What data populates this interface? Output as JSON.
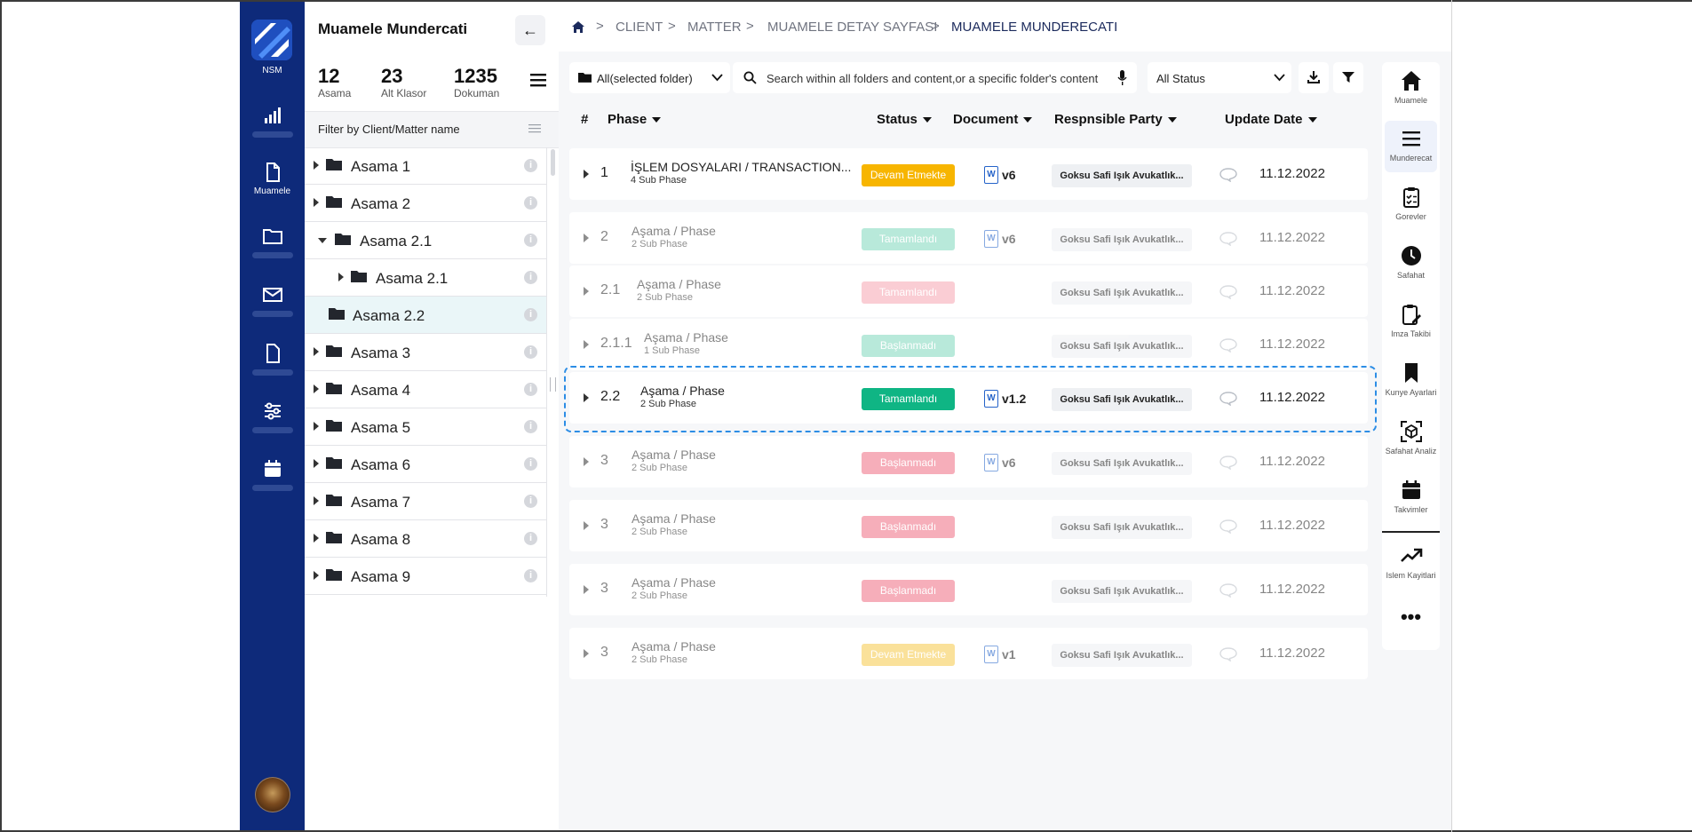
{
  "rail": {
    "logo_text": "NSM",
    "items": [
      {
        "icon": "chart-bars-icon",
        "label": ""
      },
      {
        "icon": "document-icon",
        "label": "Muamele"
      },
      {
        "icon": "folder-icon",
        "label": ""
      },
      {
        "icon": "mail-icon",
        "label": ""
      },
      {
        "icon": "file-icon",
        "label": ""
      },
      {
        "icon": "sliders-icon",
        "label": ""
      },
      {
        "icon": "calendar-icon",
        "label": ""
      }
    ]
  },
  "panel": {
    "title": "Muamele Mundercati",
    "stats": [
      {
        "value": "12",
        "label": "Asama"
      },
      {
        "value": "23",
        "label": "Alt Klasor"
      },
      {
        "value": "1235",
        "label": "Dokuman"
      }
    ],
    "filter_placeholder": "Filter by Client/Matter name",
    "tree": [
      {
        "label": "Asama 1"
      },
      {
        "label": "Asama 2"
      },
      {
        "label": "Asama 2.1"
      },
      {
        "label": "Asama 2.1"
      },
      {
        "label": "Asama 2.2"
      },
      {
        "label": "Asama 3"
      },
      {
        "label": "Asama 4"
      },
      {
        "label": "Asama 5"
      },
      {
        "label": "Asama 6"
      },
      {
        "label": "Asama 7"
      },
      {
        "label": "Asama 8"
      },
      {
        "label": "Asama 9"
      }
    ]
  },
  "breadcrumb": [
    "CLIENT",
    "MATTER",
    "MUAMELE DETAY SAYFASI",
    "MUAMELE MUNDERECATI"
  ],
  "toolbar": {
    "folder_select": "All(selected folder)",
    "search_placeholder": "Search within all folders and content,or a specific folder's content",
    "status_select": "All Status"
  },
  "grid": {
    "columns": {
      "hash": "#",
      "phase": "Phase",
      "status": "Status",
      "document": "Document",
      "party": "Respnsible Party",
      "date": "Update Date"
    },
    "rows": [
      {
        "num": "1",
        "title": "İŞLEM DOSYALARI / TRANSACTION...",
        "sub": "4 Sub Phase",
        "status": "Devam Etmekte",
        "status_color": "#f7b500",
        "doc": "v6",
        "party": "Goksu Safi Işık Avukatlık...",
        "date": "11.12.2022"
      },
      {
        "num": "2",
        "title": "Aşama / Phase",
        "sub": "2 Sub Phase",
        "status": "Tamamlandı",
        "status_color": "#12b886",
        "doc": "v6",
        "party": "Goksu Safi Işık Avukatlık...",
        "date": "11.12.2022"
      },
      {
        "num": "2.1",
        "title": "Aşama / Phase",
        "sub": "2 Sub Phase",
        "status": "Tamamlandı",
        "status_color": "#f06d82",
        "doc": "",
        "party": "Goksu Safi Işık Avukatlık...",
        "date": "11.12.2022"
      },
      {
        "num": "2.1.1",
        "title": "Aşama / Phase",
        "sub": "1 Sub Phase",
        "status": "Başlanmadı",
        "status_color": "#12b886",
        "doc": "",
        "party": "Goksu Safi Işık Avukatlık...",
        "date": "11.12.2022"
      },
      {
        "num": "2.2",
        "title": "Aşama / Phase",
        "sub": "2 Sub Phase",
        "status": "Tamamlandı",
        "status_color": "#0fb584",
        "doc": "v1.2",
        "party": "Goksu Safi Işık Avukatlık...",
        "date": "11.12.2022"
      },
      {
        "num": "3",
        "title": "Aşama / Phase",
        "sub": "2 Sub Phase",
        "status": "Başlanmadı",
        "status_color": "#f06d82",
        "doc": "v6",
        "party": "Goksu Safi Işık Avukatlık...",
        "date": "11.12.2022"
      },
      {
        "num": "3",
        "title": "Aşama / Phase",
        "sub": "2 Sub Phase",
        "status": "Başlanmadı",
        "status_color": "#f06d82",
        "doc": "",
        "party": "Goksu Safi Işık Avukatlık...",
        "date": "11.12.2022"
      },
      {
        "num": "3",
        "title": "Aşama / Phase",
        "sub": "2 Sub Phase",
        "status": "Başlanmadı",
        "status_color": "#f06d82",
        "doc": "",
        "party": "Goksu Safi Işık Avukatlık...",
        "date": "11.12.2022"
      },
      {
        "num": "3",
        "title": "Aşama / Phase",
        "sub": "2 Sub Phase",
        "status": "Devam Etmekte",
        "status_color": "#f7c948",
        "doc": "v1",
        "party": "Goksu Safi Işık Avukatlık...",
        "date": "11.12.2022"
      }
    ]
  },
  "right_toolbar": [
    {
      "icon": "home-icon",
      "label": "Muamele"
    },
    {
      "icon": "list-icon",
      "label": "Munderecat"
    },
    {
      "icon": "clipboard-check-icon",
      "label": "Gorevler"
    },
    {
      "icon": "clock-icon",
      "label": "Safahat"
    },
    {
      "icon": "clipboard-pen-icon",
      "label": "Imza Takibi"
    },
    {
      "icon": "bookmark-icon",
      "label": "Kunye Ayarlari"
    },
    {
      "icon": "scan-cube-icon",
      "label": "Safahat Analiz"
    },
    {
      "icon": "calendar-icon",
      "label": "Takvimler"
    },
    {
      "icon": "trending-up-icon",
      "label": "Islem Kayitlari"
    }
  ],
  "colors": {
    "rail": "#0e2a7a",
    "accent": "#2c8de5",
    "success": "#12b886",
    "warning": "#f7b500",
    "danger": "#f06d82"
  }
}
